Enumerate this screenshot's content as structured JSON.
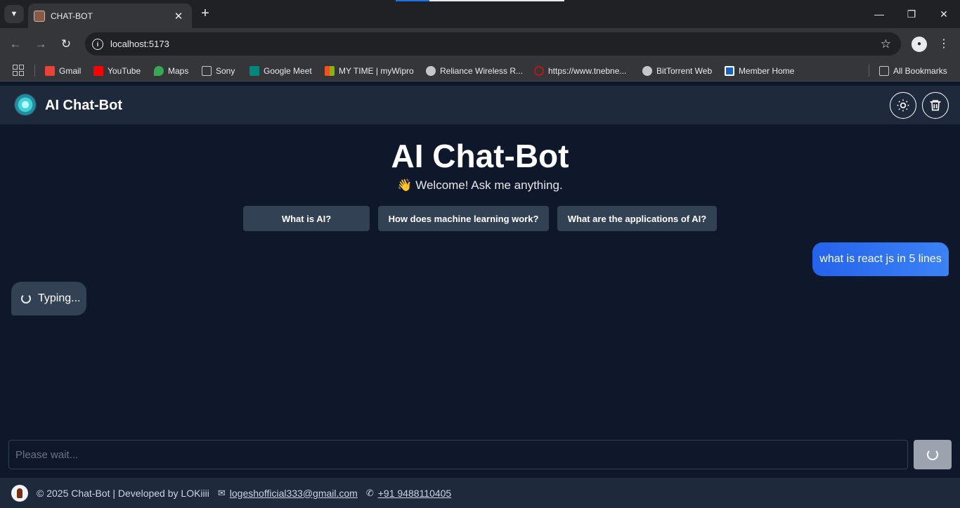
{
  "browser": {
    "tab_title": "CHAT-BOT",
    "url": "localhost:5173",
    "bookmarks": [
      {
        "label": "Gmail",
        "color": "#ea4335"
      },
      {
        "label": "YouTube",
        "color": "#ff0000"
      },
      {
        "label": "Maps",
        "color": "#34a853"
      },
      {
        "label": "Sony",
        "color": "#c4c7c5"
      },
      {
        "label": "Google Meet",
        "color": "#00897b"
      },
      {
        "label": "MY TIME | myWipro",
        "color": "#f25022"
      },
      {
        "label": "Reliance Wireless R...",
        "color": "#c4c7c5"
      },
      {
        "label": "https://www.tnebne...",
        "color": "#b31b1b"
      },
      {
        "label": "BitTorrent Web",
        "color": "#c4c7c5"
      },
      {
        "label": "Member Home",
        "color": "#1565c0"
      }
    ],
    "all_bookmarks": "All Bookmarks"
  },
  "app": {
    "header_title": "AI Chat-Bot",
    "main_title": "AI Chat-Bot",
    "welcome": "👋 Welcome! Ask me anything.",
    "suggestions": [
      "What is AI?",
      "How does machine learning work?",
      "What are the applications of AI?"
    ],
    "messages": {
      "user": "what is react js in 5 lines",
      "bot_status": "Typing..."
    },
    "input": {
      "placeholder": "Please wait..."
    },
    "footer": {
      "text": "© 2025 Chat-Bot | Developed by LOKiiii",
      "email": "logeshofficial333@gmail.com",
      "phone": "+91 9488110405"
    }
  }
}
